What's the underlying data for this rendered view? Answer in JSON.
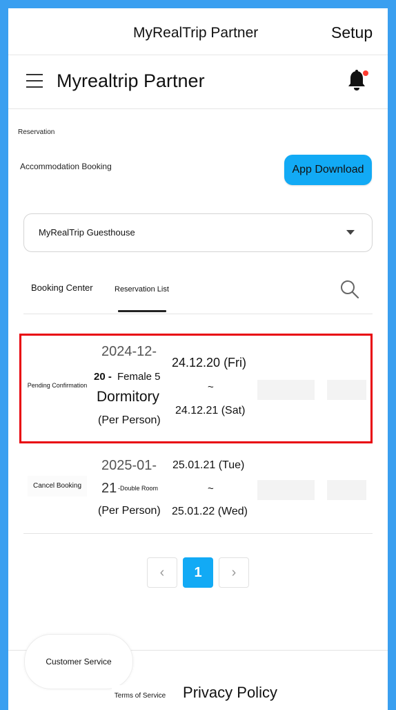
{
  "window": {
    "title": "MyRealTrip Partner",
    "setup_label": "Setup"
  },
  "header": {
    "menu_icon": "hamburger-menu-icon",
    "title": "Myrealtrip Partner",
    "bell_icon": "bell-icon",
    "notification_dot_color": "#ff3b30"
  },
  "breadcrumb": "Reservation",
  "section": {
    "title": "Accommodation Booking",
    "app_download_label": "App Download",
    "accent_color": "#12aaf5"
  },
  "property_select": {
    "value": "MyRealTrip Guesthouse",
    "caret_icon": "caret-down-icon"
  },
  "tabs": [
    {
      "label": "Booking Center",
      "active": false
    },
    {
      "label": "Reservation List",
      "active": true
    }
  ],
  "search_icon": "search-icon",
  "reservations": [
    {
      "status": "Pending Confirmation",
      "date_line1": "2024-12-",
      "date_part2": "20",
      "separator": " - ",
      "room_part1": "Female 5",
      "room_part2": "Dormitory",
      "unit": "(Per Person)",
      "check_in": "24.12.20 (Fri)",
      "tilde": "~",
      "check_out": "24.12.21 (Sat)",
      "highlighted": true
    },
    {
      "status": "Cancel Booking",
      "date_line1": "2025-01-",
      "date_part2": "21",
      "room": "-Double Room",
      "unit": "(Per Person)",
      "check_in": "25.01.21 (Tue)",
      "tilde": "~",
      "check_out": "25.01.22 (Wed)",
      "highlighted": false
    }
  ],
  "pagination": {
    "prev": "‹",
    "current": "1",
    "next": "›"
  },
  "footer": {
    "customer_service": "Customer Service",
    "terms": "Terms of Service",
    "privacy": "Privacy Policy"
  }
}
